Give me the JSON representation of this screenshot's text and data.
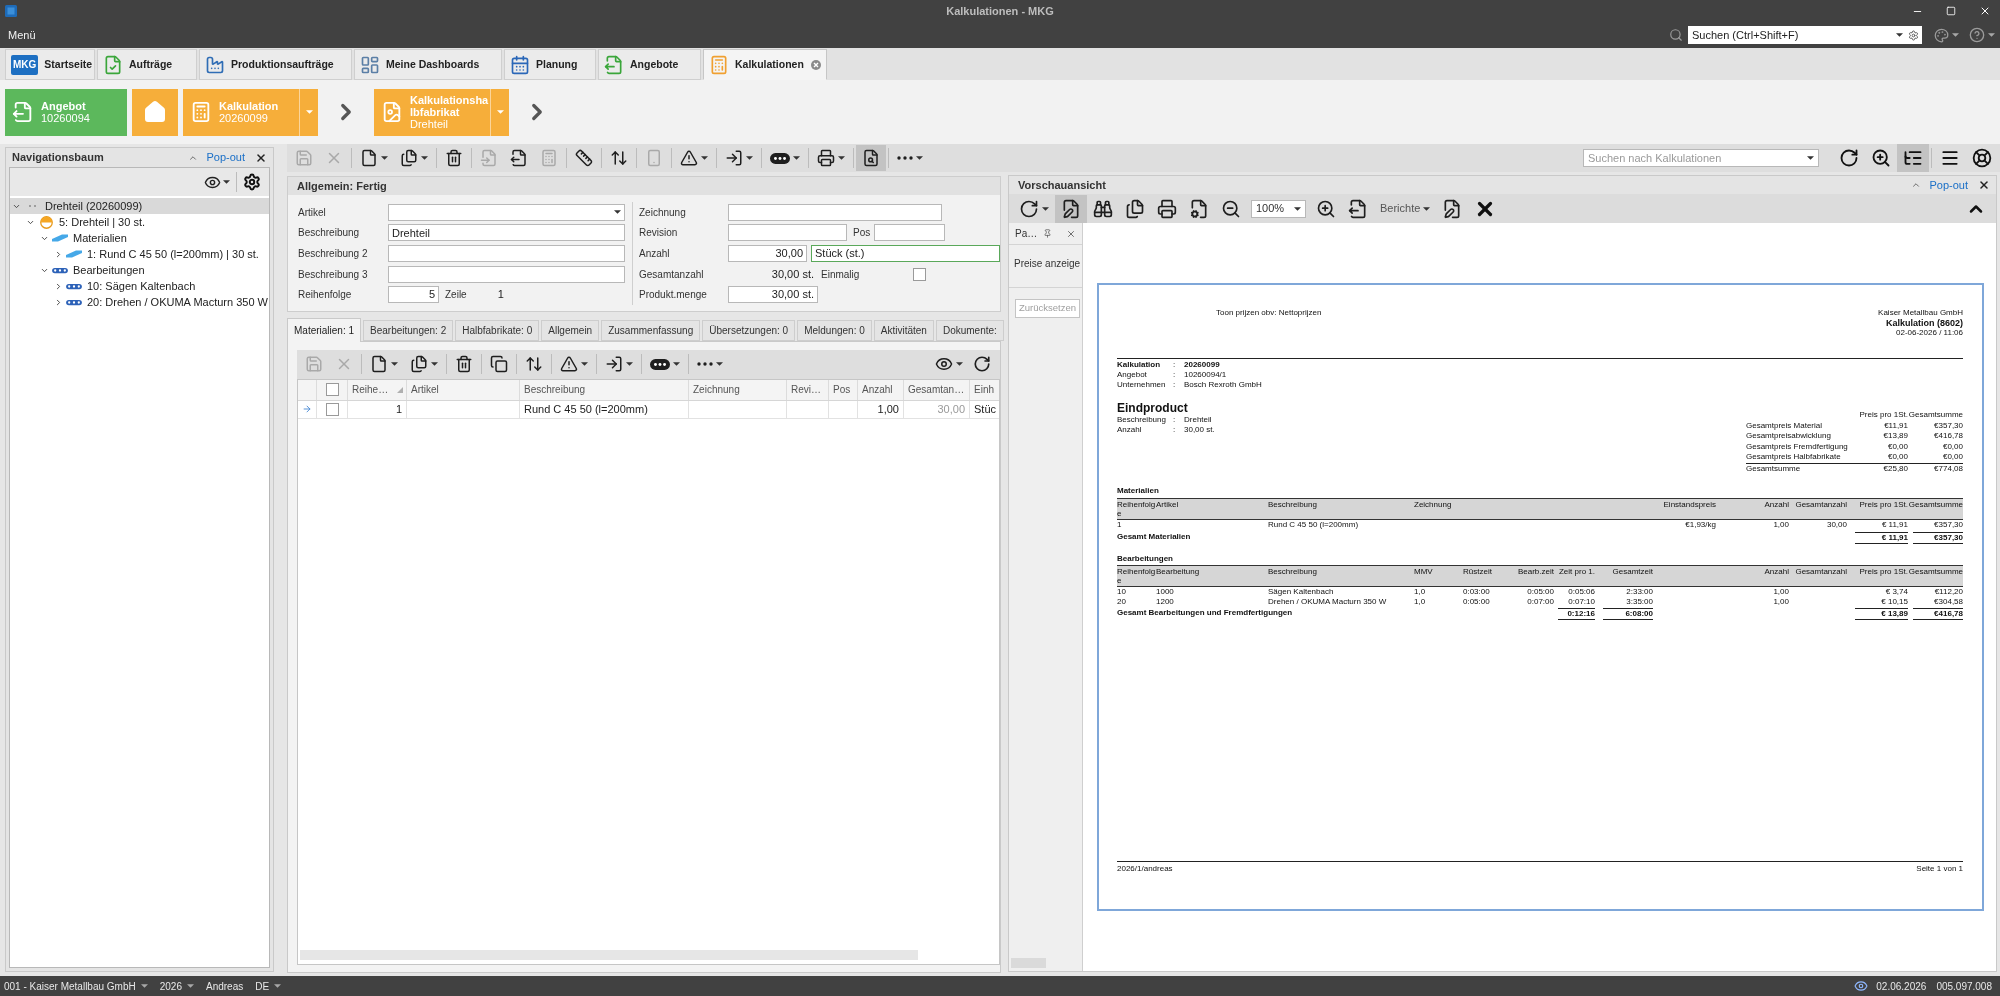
{
  "window": {
    "title": "Kalkulationen - MKG"
  },
  "menu_bar": {
    "menu": "Menü",
    "search": {
      "placeholder": "Suchen (Ctrl+Shift+F)"
    }
  },
  "tabs": [
    {
      "label": "Startseite",
      "logo": "MKG",
      "selected": false
    },
    {
      "label": "Aufträge",
      "selected": false
    },
    {
      "label": "Produktionsaufträge",
      "selected": false
    },
    {
      "label": "Meine Dashboards",
      "selected": false
    },
    {
      "label": "Planung",
      "selected": false
    },
    {
      "label": "Angebote",
      "selected": false
    },
    {
      "label": "Kalkulationen",
      "selected": true
    }
  ],
  "breadcrumb": [
    {
      "kind": "tile",
      "title": "Angebot",
      "value": "10260094",
      "color": "#5cb85c",
      "dropdown": false
    },
    {
      "kind": "home",
      "color": "#f6ae3a"
    },
    {
      "kind": "tile",
      "title": "Kalkulation",
      "value": "20260099",
      "color": "#f6ae3a",
      "dropdown": true
    },
    {
      "kind": "chevron"
    },
    {
      "kind": "tile",
      "title": "Kalkulationshalbfabrikat",
      "value": "Drehteil",
      "color": "#f6ae3a",
      "dropdown": true
    },
    {
      "kind": "chevron"
    }
  ],
  "navigation": {
    "title": "Navigationsbaum",
    "popout": "Pop-out",
    "tree": [
      {
        "kind": "root",
        "label": "Drehteil (20260099)",
        "selected": true,
        "expanded": true,
        "children": [
          {
            "kind": "part",
            "label": "5: Drehteil | 30 st.",
            "selected": false,
            "expanded": true,
            "children": [
              {
                "kind": "material_group",
                "label": "Materialien",
                "selected": false,
                "expanded": true,
                "children": [
                  {
                    "kind": "material",
                    "label": "1: Rund C 45 50 (l=200mm) | 30 st.",
                    "selected": false,
                    "expanded": false
                  }
                ]
              },
              {
                "kind": "operation_group",
                "label": "Bearbeitungen",
                "selected": false,
                "expanded": true,
                "children": [
                  {
                    "kind": "operation",
                    "label": "10: Sägen Kaltenbach",
                    "selected": false,
                    "expanded": false
                  },
                  {
                    "kind": "operation",
                    "label": "20: Drehen / OKUMA Macturn 350 W",
                    "selected": false,
                    "expanded": false
                  }
                ]
              }
            ]
          }
        ]
      }
    ]
  },
  "toolbar": {
    "buttons": [
      {
        "disabled": true,
        "pressed": false,
        "menu": false
      },
      {
        "disabled": true,
        "pressed": false,
        "menu": false
      },
      {
        "disabled": false,
        "pressed": false,
        "menu": true
      },
      {
        "disabled": false,
        "pressed": false,
        "menu": true
      },
      {
        "disabled": false,
        "pressed": false,
        "menu": false
      },
      {
        "disabled": true,
        "pressed": false,
        "menu": false
      },
      {
        "disabled": false,
        "pressed": false,
        "menu": false
      },
      {
        "disabled": true,
        "pressed": false,
        "menu": false
      },
      {
        "disabled": false,
        "pressed": false,
        "menu": false
      },
      {
        "disabled": false,
        "pressed": false,
        "menu": false
      },
      {
        "disabled": true,
        "pressed": false,
        "menu": false
      },
      {
        "disabled": false,
        "pressed": false,
        "menu": true
      },
      {
        "disabled": false,
        "pressed": false,
        "menu": true
      },
      {
        "disabled": false,
        "pressed": false,
        "menu": true
      },
      {
        "disabled": false,
        "pressed": false,
        "menu": true
      },
      {
        "disabled": false,
        "pressed": true,
        "menu": false
      },
      {
        "disabled": false,
        "pressed": false,
        "menu": true
      }
    ],
    "search": {
      "placeholder": "Suchen nach Kalkulationen"
    },
    "right_buttons": [
      {
        "pressed": false
      },
      {
        "pressed": false
      },
      {
        "pressed": true
      },
      {
        "pressed": false
      },
      {
        "pressed": false
      }
    ]
  },
  "form": {
    "title": "Allgemein: Fertig",
    "left": [
      {
        "kind": "select",
        "label": "Artikel"
      },
      {
        "kind": "text",
        "label": "Beschreibung",
        "value": "Drehteil"
      },
      {
        "kind": "text",
        "label": "Beschreibung 2"
      },
      {
        "kind": "text",
        "label": "Beschreibung 3"
      },
      {
        "kind": "number",
        "label": "Reihenfolge",
        "value": "5",
        "extra_label": "Zeile",
        "extra_value": "1"
      }
    ],
    "right": [
      {
        "kind": "text",
        "label": "Zeichnung"
      },
      {
        "kind": "text_pos",
        "label": "Revision",
        "extra_label": "Pos"
      },
      {
        "kind": "number_unit",
        "label": "Anzahl",
        "value": "30,00",
        "unit": "Stück (st.)",
        "focused": true
      },
      {
        "kind": "readonly_check",
        "label": "Gesamtanzahl",
        "value": "30,00 st.",
        "extra_label": "Einmalig",
        "checked": false
      },
      {
        "kind": "number",
        "label": "Produkt.menge",
        "value": "30,00 st."
      }
    ]
  },
  "detail_tabs": [
    {
      "label": "Materialien: 1",
      "selected": true
    },
    {
      "label": "Bearbeitungen: 2",
      "selected": false
    },
    {
      "label": "Halbfabrikate: 0",
      "selected": false
    },
    {
      "label": "Allgemein",
      "selected": false
    },
    {
      "label": "Zusammenfassung",
      "selected": false
    },
    {
      "label": "Übersetzungen: 0",
      "selected": false
    },
    {
      "label": "Meldungen: 0",
      "selected": false
    },
    {
      "label": "Aktivitäten",
      "selected": false
    },
    {
      "label": "Dokumente:",
      "selected": false
    }
  ],
  "sub_toolbar": {
    "buttons": [
      {
        "disabled": true,
        "menu": false
      },
      {
        "disabled": true,
        "menu": false
      },
      {
        "disabled": false,
        "menu": true
      },
      {
        "disabled": false,
        "menu": true
      },
      {
        "disabled": false,
        "menu": false
      },
      {
        "disabled": false,
        "menu": false
      },
      {
        "disabled": false,
        "menu": false
      },
      {
        "disabled": false,
        "menu": true
      },
      {
        "disabled": false,
        "menu": true
      },
      {
        "disabled": false,
        "menu": true
      },
      {
        "disabled": false,
        "menu": true
      }
    ],
    "right_buttons": [
      {
        "menu": true
      },
      {
        "menu": false
      }
    ]
  },
  "table": {
    "select_all_checked": false,
    "columns": [
      {
        "label": "Reihe…",
        "sorted": true,
        "readonly": false
      },
      {
        "label": "Artikel",
        "sorted": false,
        "readonly": false
      },
      {
        "label": "Beschreibung",
        "sorted": false,
        "readonly": false
      },
      {
        "label": "Zeichnung",
        "sorted": false,
        "readonly": false
      },
      {
        "label": "Revi…",
        "sorted": false,
        "readonly": false
      },
      {
        "label": "Pos",
        "sorted": false,
        "readonly": false
      },
      {
        "label": "Anzahl",
        "sorted": false,
        "readonly": false
      },
      {
        "label": "Gesamtan…",
        "sorted": false,
        "readonly": true
      },
      {
        "label": "Einh",
        "sorted": false,
        "readonly": false
      }
    ],
    "rows": [
      {
        "current": true,
        "checked": false,
        "cells": [
          "1",
          null,
          "Rund C 45 50 (l=200mm)",
          null,
          null,
          null,
          "1,00",
          "30,00",
          "Stüc"
        ]
      }
    ]
  },
  "preview": {
    "title": "Vorschauansicht",
    "popout": "Pop-out",
    "toolbar": [
      {
        "kind": "button",
        "pressed": false,
        "menu": true
      },
      {
        "kind": "button",
        "pressed": true,
        "menu": false
      },
      {
        "kind": "button",
        "pressed": false,
        "menu": false
      },
      {
        "kind": "button",
        "pressed": false,
        "menu": false
      },
      {
        "kind": "button",
        "pressed": false,
        "menu": false
      },
      {
        "kind": "button",
        "pressed": false,
        "menu": false
      },
      {
        "kind": "button",
        "pressed": false,
        "menu": false
      },
      {
        "kind": "combo",
        "value": "100%"
      },
      {
        "kind": "button",
        "pressed": false,
        "menu": false
      },
      {
        "kind": "button",
        "pressed": false,
        "menu": false
      },
      {
        "kind": "menu",
        "label": "Berichte"
      },
      {
        "kind": "button",
        "pressed": false,
        "menu": false
      },
      {
        "kind": "button",
        "pressed": false,
        "menu": false
      }
    ],
    "parameters": {
      "title": "Pa…",
      "show_prices": "Preise anzeige",
      "reset": {
        "label": "Zurücksetzen",
        "disabled": true
      }
    },
    "report": {
      "note": "Toon prijzen obv: Nettoprijzen",
      "company": "Kaiser Metallbau GmbH",
      "title": "Kalkulation (8602)",
      "date": "02-06-2026 / 11:06",
      "info": [
        {
          "label": "Kalkulation",
          "sep": ":",
          "value": "20260099"
        },
        {
          "label": "Angebot",
          "sep": ":",
          "value": "10260094/1"
        },
        {
          "label": "Unternehmen",
          "sep": ":",
          "value": "Bosch Rexroth GmbH"
        }
      ],
      "product": {
        "heading": "Eindproduct",
        "details": [
          {
            "label": "Beschreibung",
            "sep": ":",
            "value": "Drehteil"
          },
          {
            "label": "Anzahl",
            "sep": ":",
            "value": "30,00 st."
          }
        ]
      },
      "summary": {
        "columns": [
          "Preis pro 1St.",
          "Gesamtsumme"
        ],
        "rows": [
          {
            "label": "Gesamtpreis Material",
            "price": "€11,91",
            "total": "€357,30"
          },
          {
            "label": "Gesamtpreisabwicklung",
            "price": "€13,89",
            "total": "€416,78"
          },
          {
            "label": "Gesamtpreis Fremdfertigung",
            "price": "€0,00",
            "total": "€0,00"
          },
          {
            "label": "Gesamtpreis Halbfabrikate",
            "price": "€0,00",
            "total": "€0,00"
          }
        ],
        "total": {
          "label": "Gesamtsumme",
          "price": "€25,80",
          "total": "€774,08"
        }
      },
      "materials": {
        "heading": "Materialien",
        "columns": [
          "Reihenfolge",
          "Artikel",
          "Beschreibung",
          "Zeichnung",
          "Einstandspreis",
          "Anzahl",
          "Gesamtanzahl",
          "Preis pro 1St.",
          "Gesamtsumme"
        ],
        "rows": [
          [
            "1",
            null,
            "Rund C 45 50 (l=200mm)",
            null,
            "€1,93/kg",
            "1,00",
            "30,00",
            "€ 11,91",
            "€357,30"
          ]
        ],
        "total": {
          "label": "Gesamt Materialien",
          "price": "€ 11,91",
          "total": "€357,30"
        }
      },
      "operations": {
        "heading": "Bearbeitungen",
        "columns": [
          "Reihenfolge",
          "Bearbeitung",
          "Beschreibung",
          "MMV",
          "Rüstzeit",
          "Bearb.zeit",
          "Zeit pro 1.",
          "Gesamtzeit",
          "Anzahl",
          "Gesamtanzahl",
          "Preis pro 1St.",
          "Gesamtsumme"
        ],
        "rows": [
          [
            "10",
            "1000",
            "Sägen Kaltenbach",
            "1,0",
            "0:03:00",
            "0:05:00",
            "0:05:06",
            "2:33:00",
            "1,00",
            null,
            "€ 3,74",
            "€112,20"
          ],
          [
            "20",
            "1200",
            "Drehen / OKUMA Macturn 350 W",
            "1,0",
            "0:05:00",
            "0:07:00",
            "0:07:10",
            "3:35:00",
            "1,00",
            null,
            "€ 10,15",
            "€304,58"
          ]
        ],
        "total": {
          "label": "Gesamt Bearbeitungen und Fremdfertigungen",
          "time_per_unit": "0:12:16",
          "total_time": "6:08:00",
          "price": "€ 13,89",
          "total": "€416,78"
        }
      },
      "footer": {
        "left": "2026/1/andreas",
        "right": "Seite 1 von 1"
      }
    }
  },
  "status_bar": {
    "items": [
      {
        "label": "001 - Kaiser Metallbau GmbH",
        "dropdown": true
      },
      {
        "label": "2026",
        "dropdown": true
      },
      {
        "label": "Andreas",
        "dropdown": false
      },
      {
        "label": "DE",
        "dropdown": true
      }
    ],
    "date": "02.06.2026",
    "version": "005.097.008"
  }
}
